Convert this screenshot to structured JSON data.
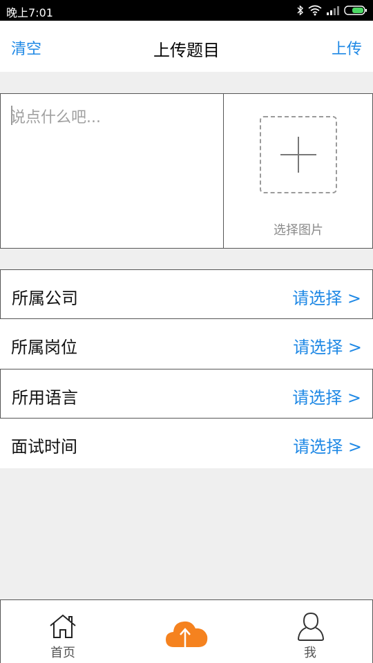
{
  "statusbar": {
    "time": "晚上7:01"
  },
  "navbar": {
    "clear_label": "清空",
    "title": "上传题目",
    "upload_label": "上传"
  },
  "compose": {
    "placeholder": "说点什么吧...",
    "pick_image_label": "选择图片"
  },
  "fields": [
    {
      "label": "所属公司",
      "value": "请选择 >"
    },
    {
      "label": "所属岗位",
      "value": "请选择 >"
    },
    {
      "label": "所用语言",
      "value": "请选择 >"
    },
    {
      "label": "面试时间",
      "value": "请选择 >"
    }
  ],
  "tabbar": {
    "items": [
      {
        "label": "首页",
        "icon": "home-icon"
      },
      {
        "label": "",
        "icon": "cloud-upload-icon"
      },
      {
        "label": "我",
        "icon": "user-icon"
      }
    ]
  },
  "colors": {
    "accent": "#1e88e5",
    "upload_orange": "#f5821f"
  }
}
